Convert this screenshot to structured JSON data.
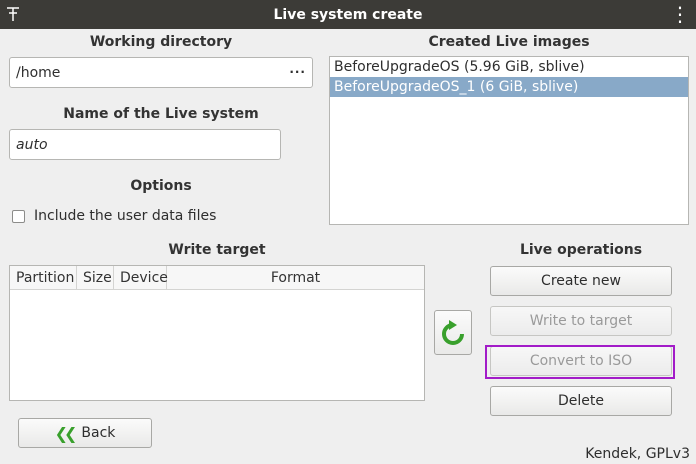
{
  "window": {
    "title": "Live system create"
  },
  "working_directory": {
    "heading": "Working directory",
    "value": "/home",
    "browse_label": "..."
  },
  "live_name": {
    "heading": "Name of the Live system",
    "value": "auto"
  },
  "options": {
    "heading": "Options",
    "include_user_data_label": "Include the user data files",
    "include_user_data_checked": false
  },
  "created_images": {
    "heading": "Created Live images",
    "items": [
      {
        "label": "BeforeUpgradeOS (5.96 GiB, sblive)",
        "selected": false
      },
      {
        "label": "BeforeUpgradeOS_1 (6 GiB, sblive)",
        "selected": true
      }
    ]
  },
  "write_target": {
    "heading": "Write target",
    "columns": [
      "Partition",
      "Size",
      "Device",
      "Format"
    ],
    "rows": []
  },
  "live_operations": {
    "heading": "Live operations",
    "create_new": "Create new",
    "write_to_target": "Write to target",
    "convert_to_iso": "Convert to ISO",
    "delete": "Delete"
  },
  "back_label": "Back",
  "footer": "Kendek, GPLv3",
  "colors": {
    "titlebar": "#3c3b37",
    "selection": "#88a9c8",
    "highlight": "#a21bc8",
    "refresh_arrow": "#39a02c"
  }
}
